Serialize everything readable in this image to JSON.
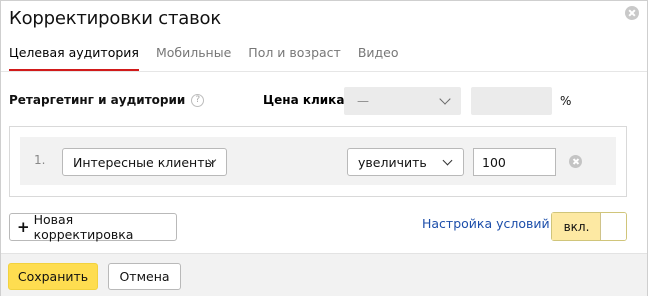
{
  "dialog": {
    "title": "Корректировки ставок",
    "close_icon": "close-icon"
  },
  "tabs": [
    {
      "label": "Целевая аудитория",
      "active": true
    },
    {
      "label": "Мобильные",
      "active": false
    },
    {
      "label": "Пол и возраст",
      "active": false
    },
    {
      "label": "Видео",
      "active": false
    }
  ],
  "header_row": {
    "section_label": "Ретаргетинг и аудитории",
    "help_icon": "help-icon",
    "help_glyph": "?",
    "price_label": "Цена клика",
    "price_select_value": "—",
    "percent_sign": "%"
  },
  "adjustments": [
    {
      "number": "1.",
      "audience": "Интересные клиенты",
      "direction": "увеличить",
      "value": "100"
    }
  ],
  "actions": {
    "add_label": "Новая корректировка",
    "settings_link": "Настройка условий",
    "toggle_label": "вкл."
  },
  "footer": {
    "save_label": "Сохранить",
    "cancel_label": "Отмена"
  },
  "colors": {
    "active_tab_underline": "#d11a1a",
    "link": "#1c4eaa",
    "primary_button": "#fedd50",
    "toggle_on": "#fde9a3"
  }
}
